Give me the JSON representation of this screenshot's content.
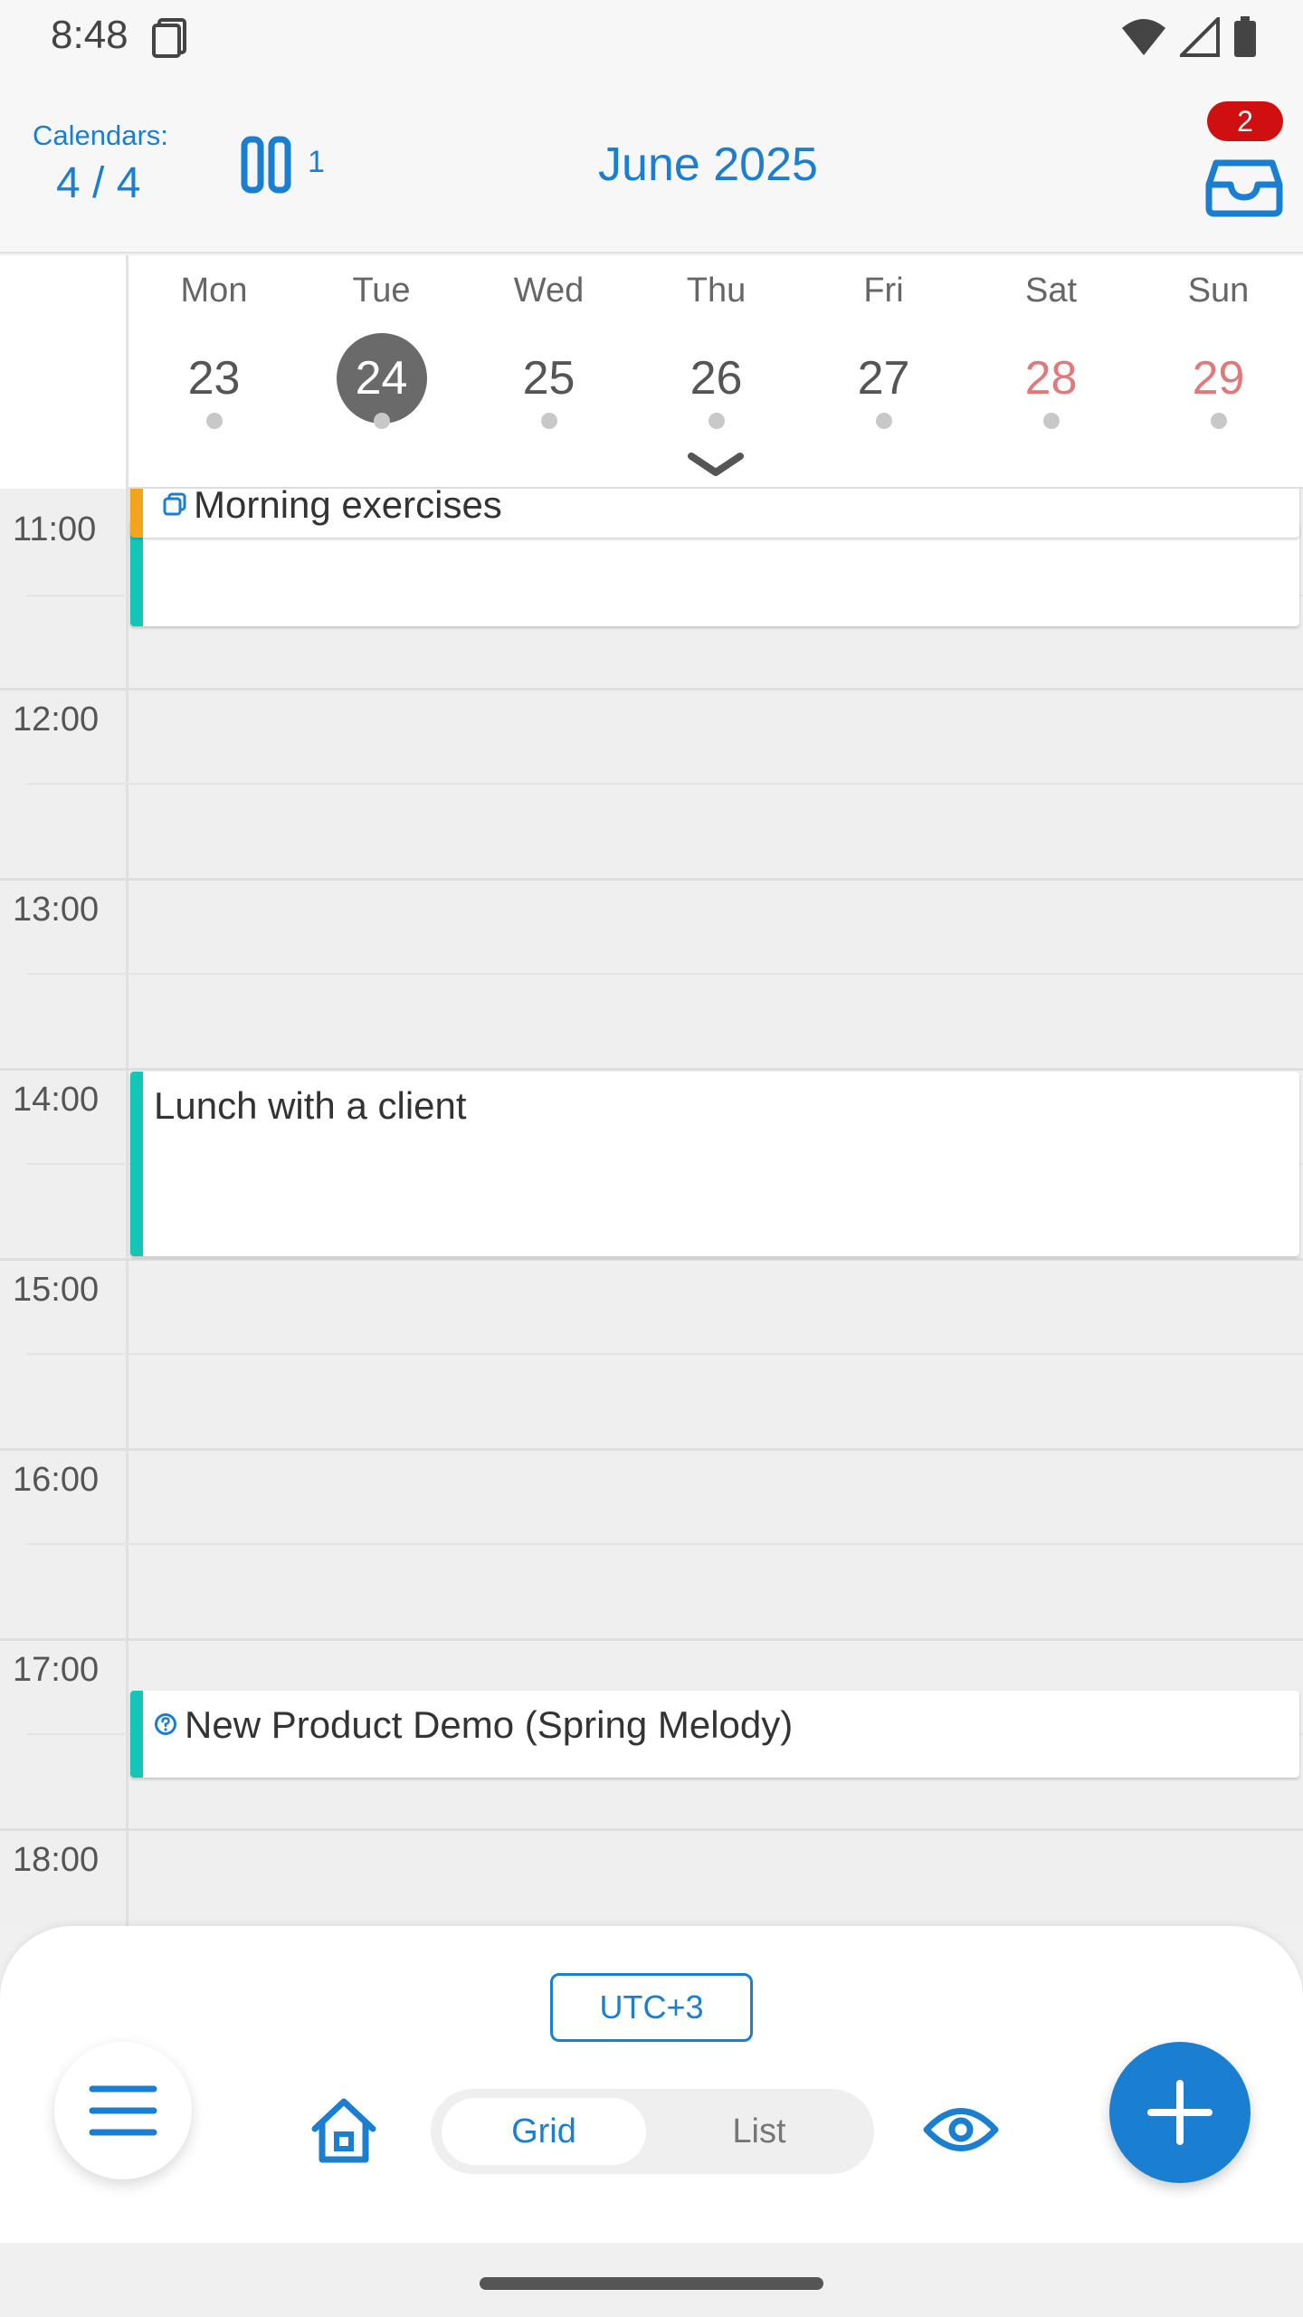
{
  "status_bar": {
    "time": "8:48",
    "icons": [
      "sim-card-icon",
      "wifi-icon",
      "cell-signal-icon",
      "battery-icon"
    ]
  },
  "header": {
    "calendars_label": "Calendars:",
    "calendars_count": "4 / 4",
    "columns_count": "1",
    "month_title": "June 2025",
    "inbox_badge": "2"
  },
  "week": {
    "days": [
      {
        "name": "Mon",
        "num": "23"
      },
      {
        "name": "Tue",
        "num": "24",
        "today": true
      },
      {
        "name": "Wed",
        "num": "25"
      },
      {
        "name": "Thu",
        "num": "26"
      },
      {
        "name": "Fri",
        "num": "27"
      },
      {
        "name": "Sat",
        "num": "28",
        "weekend": true
      },
      {
        "name": "Sun",
        "num": "29",
        "weekend": true
      }
    ]
  },
  "grid": {
    "hours": [
      "11:00",
      "12:00",
      "13:00",
      "14:00",
      "15:00",
      "16:00",
      "17:00",
      "18:00"
    ],
    "events": {
      "morning": "Morning exercises",
      "lunch": "Lunch with a client",
      "demo": "New Product Demo (Spring Melody)"
    }
  },
  "bottom": {
    "timezone": "UTC+3",
    "view_grid": "Grid",
    "view_list": "List"
  },
  "colors": {
    "accent": "#1a7fd1",
    "event_teal": "#14c6b8",
    "event_orange": "#f3a41d",
    "badge_red": "#d01010",
    "weekend_red": "#e07a7a"
  }
}
